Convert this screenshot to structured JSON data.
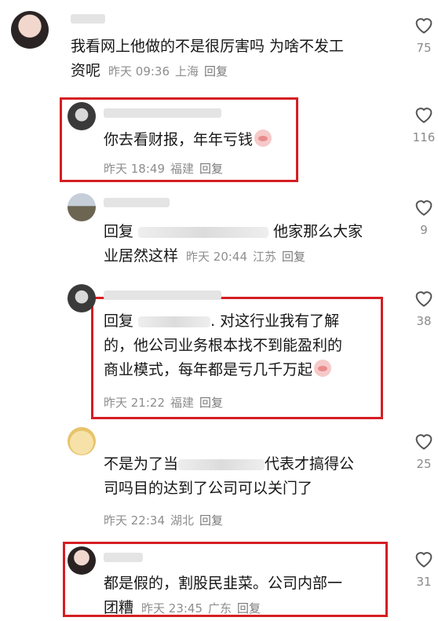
{
  "comments": [
    {
      "text_lines": [
        "我看网上他做的不是很厉害吗 为啥不发工",
        "资呢"
      ],
      "time": "昨天 09:36",
      "location": "上海",
      "reply_label": "回复",
      "likes": "75"
    },
    {
      "text_lines": [
        "你去看财报，年年亏钱"
      ],
      "time": "昨天 18:49",
      "location": "福建",
      "reply_label": "回复",
      "likes": "116"
    },
    {
      "prefix": "回复",
      "text_after": "他家那么大家",
      "text_line2": "业居然这样",
      "time": "昨天 20:44",
      "location": "江苏",
      "reply_label": "回复",
      "likes": "9"
    },
    {
      "prefix": "回复",
      "text_after": ". 对这行业我有了解",
      "text_lines": [
        "的，他公司业务根本找不到能盈利的",
        "商业模式，每年都是亏几千万起"
      ],
      "time": "昨天 21:22",
      "location": "福建",
      "reply_label": "回复",
      "likes": "38"
    },
    {
      "text_before": "不是为了当",
      "text_after": "代表才搞得公",
      "text_lines": [
        "司吗目的达到了公司可以关门了"
      ],
      "time": "昨天 22:34",
      "location": "湖北",
      "reply_label": "回复",
      "likes": "25"
    },
    {
      "text_lines": [
        "都是假的，割股民韭菜。公司内部一",
        "团糟"
      ],
      "time": "昨天 23:45",
      "location": "广东",
      "reply_label": "回复",
      "likes": "31"
    }
  ],
  "colors": {
    "highlight": "#d51e23",
    "meta_text": "#8e8e8e",
    "body_text": "#161616"
  },
  "icons": [
    "heart-outline-icon",
    "cry-emoji-icon"
  ]
}
